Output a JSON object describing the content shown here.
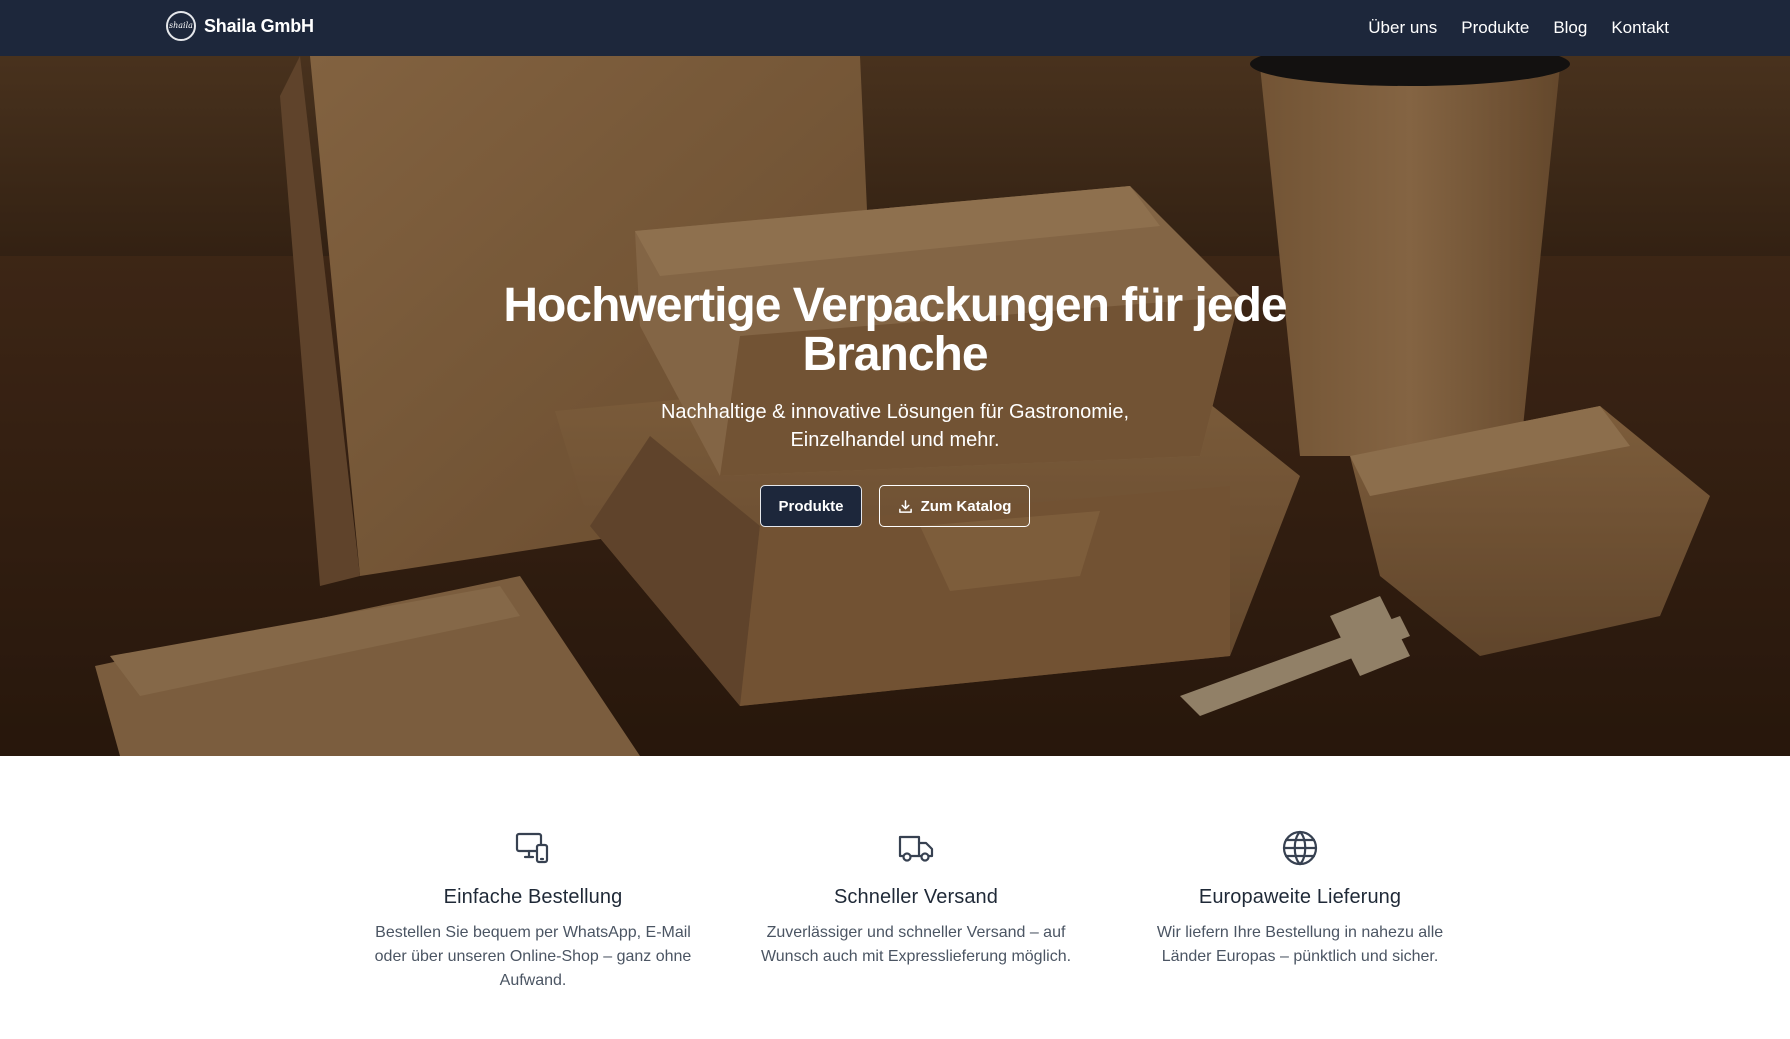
{
  "brand": {
    "logo_text": "shaila",
    "name": "Shaila GmbH"
  },
  "nav": {
    "items": [
      {
        "label": "Über uns"
      },
      {
        "label": "Produkte"
      },
      {
        "label": "Blog"
      },
      {
        "label": "Kontakt"
      }
    ]
  },
  "hero": {
    "title": "Hochwertige Verpackungen für jede Branche",
    "subtitle": "Nachhaltige & innovative Lösungen für Gastronomie, Einzelhandel und mehr.",
    "primary_button": "Produkte",
    "secondary_button": "Zum Katalog",
    "secondary_button_icon": "download-icon"
  },
  "features": [
    {
      "icon": "devices-icon",
      "title": "Einfache Bestellung",
      "text": "Bestellen Sie bequem per WhatsApp, E-Mail oder über unseren Online-Shop – ganz ohne Aufwand."
    },
    {
      "icon": "truck-icon",
      "title": "Schneller Versand",
      "text": "Zuverlässiger und schneller Versand – auf Wunsch auch mit Expresslieferung möglich."
    },
    {
      "icon": "globe-icon",
      "title": "Europaweite Lieferung",
      "text": "Wir liefern Ihre Bestellung in nahezu alle Länder Europas – pünktlich und sicher."
    }
  ],
  "colors": {
    "navbar": "#1d273b",
    "hero_wood": "#4a2f1a",
    "kraft": "#b08354",
    "icon": "#374151"
  }
}
